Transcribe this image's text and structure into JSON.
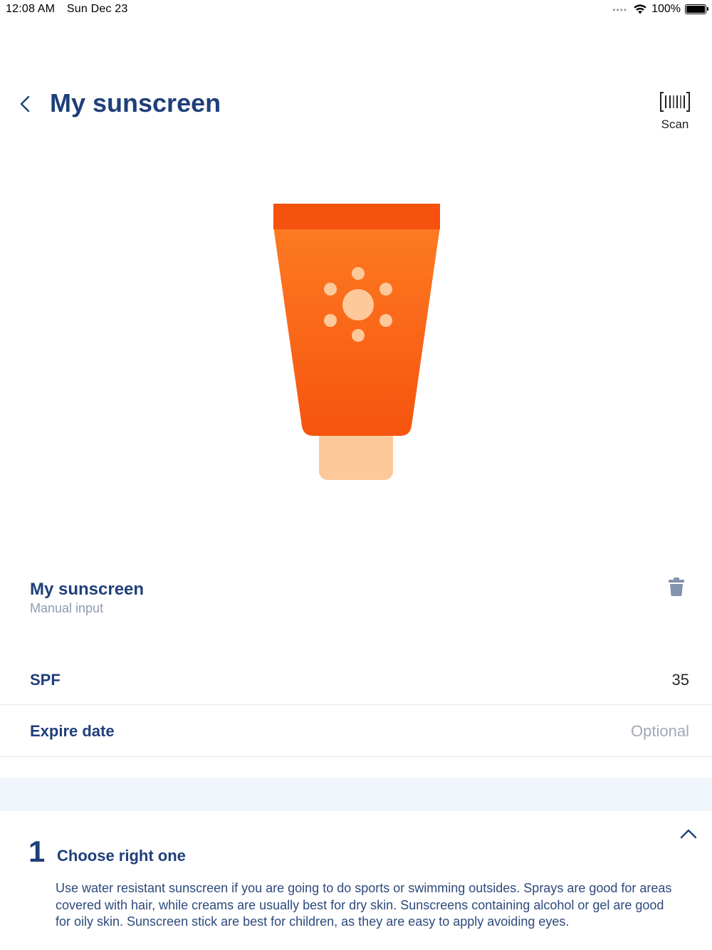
{
  "status_bar": {
    "time": "12:08 AM",
    "date": "Sun Dec 23",
    "signal": "••••",
    "battery": "100%"
  },
  "header": {
    "title": "My sunscreen",
    "back_icon": "chevron-left-icon",
    "scan_icon": "barcode-icon",
    "scan_label": "Scan"
  },
  "illustration": {
    "icon": "sunscreen-tube-illustration",
    "colors": {
      "cap_top": "#f5520f",
      "body": "#fb6a1a",
      "sun": "#fdc99b",
      "nozzle": "#fdc99b"
    }
  },
  "product": {
    "name": "My sunscreen",
    "source": "Manual input",
    "delete_icon": "trash-icon"
  },
  "fields": {
    "spf": {
      "label": "SPF",
      "value": "35"
    },
    "expire": {
      "label": "Expire date",
      "placeholder": "Optional"
    }
  },
  "tip": {
    "number": "1",
    "title": "Choose right one",
    "collapse_icon": "chevron-up-icon",
    "body": "Use water resistant sunscreen if you are going to do sports or swimming outsides.  Sprays are good for areas covered with hair, while creams are usually best for dry skin. Sunscreens containing alcohol or gel are good for oily skin. Sunscreen stick are best for children, as they are easy to apply avoiding eyes."
  },
  "colors": {
    "accent": "#1f3f7a",
    "muted": "#8e9bb4",
    "section_bg": "#f1f5fc"
  }
}
